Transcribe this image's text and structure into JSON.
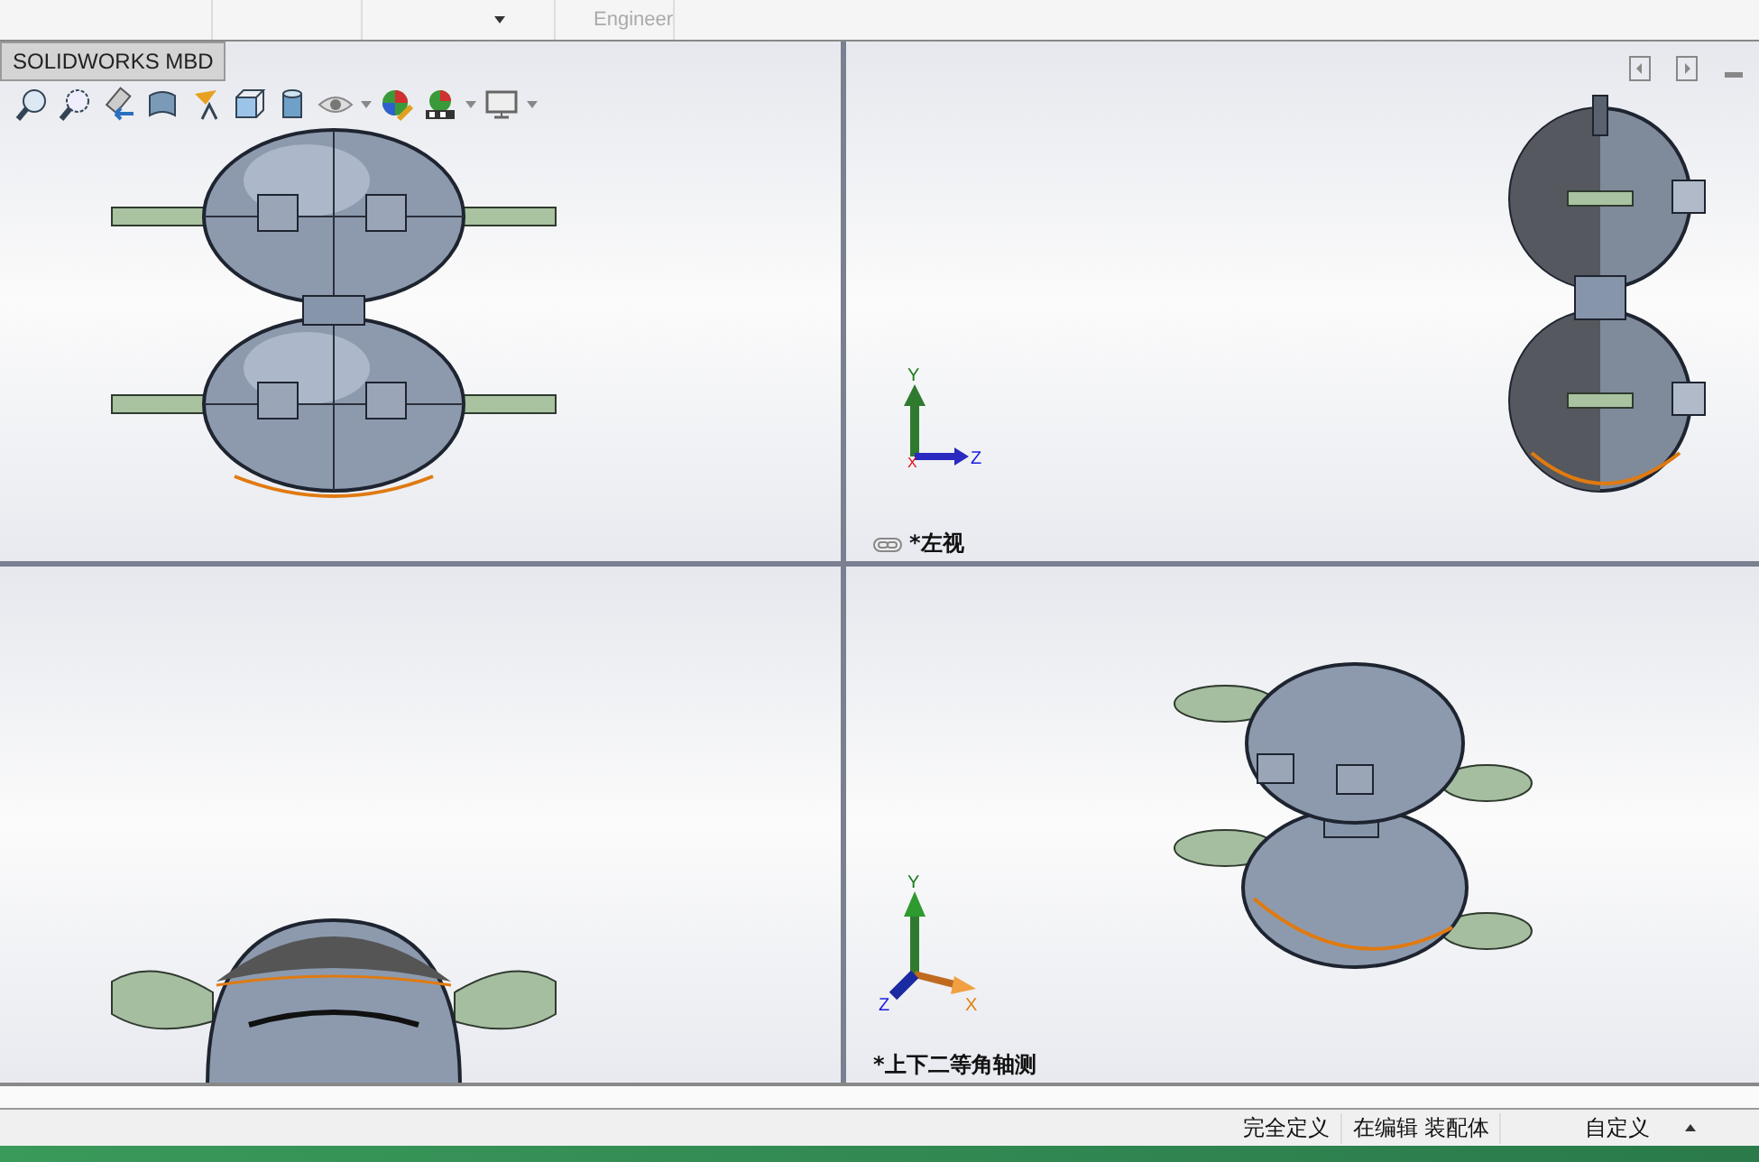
{
  "top_bar": {
    "column_4": "Engineer"
  },
  "mbd_tab": {
    "label": "SOLIDWORKS MBD"
  },
  "viewports": [
    {
      "kind": "front"
    },
    {
      "kind": "side",
      "view_name": "*左视",
      "triad": {
        "y": "Y",
        "x": "X",
        "z": "Z"
      }
    },
    {
      "kind": "bottom"
    },
    {
      "kind": "iso",
      "view_name": "*上下二等角轴测",
      "triad": {
        "y": "Y",
        "x": "X",
        "z": "Z"
      }
    }
  ],
  "status_bar": [
    "完全定义",
    "在编辑 装配体",
    "自定义"
  ]
}
